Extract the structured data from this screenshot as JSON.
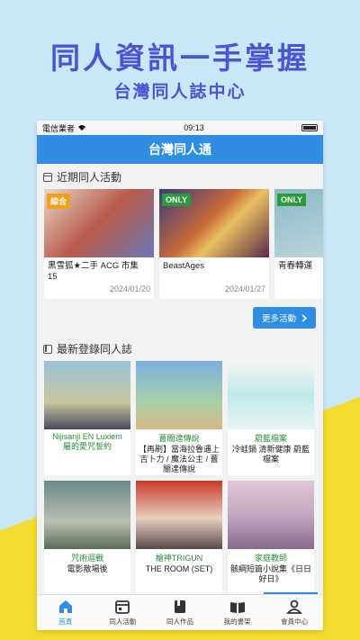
{
  "promo": {
    "headline": "同人資訊一手掌握",
    "subline": "台灣同人誌中心"
  },
  "status_bar": {
    "carrier": "電信業者",
    "time": "09:13"
  },
  "navbar": {
    "title": "台灣同人通"
  },
  "events_section": {
    "title": "近期同人活動",
    "items": [
      {
        "badge": "綜合",
        "badge_color": "#f0a020",
        "title": "黑雪狐★二手 ACG 市集 15",
        "date": "2024/01/20"
      },
      {
        "badge": "ONLY",
        "badge_color": "#2a9a3a",
        "title": "BeastAges",
        "date": "2024/01/27"
      },
      {
        "badge": "ONLY",
        "badge_color": "#2a9a3a",
        "title": "青春轉運",
        "date": ""
      }
    ],
    "more_label": "更多活動"
  },
  "books_section": {
    "title": "最新登錄同人誌",
    "items": [
      {
        "category": "",
        "name": "Nijisanji EN Luxiem\n屬的愛咒誓約",
        "name_color": "#2a8a3a"
      },
      {
        "category": "薔闇達傳說",
        "name": "【再刷】當海拉魯遇上吉卜力 / 魔法公主 / 薔闇達傳說"
      },
      {
        "category": "蔚藍檔案",
        "name": "冷蛙鍋 清新健康 蔚藍檔案"
      },
      {
        "category": "咒術迴戰",
        "name": "電影散場後"
      },
      {
        "category": "槍神TRIGUN",
        "name": "THE ROOM (SET)"
      },
      {
        "category": "家庭教師",
        "name": "骸綱短篇小說集《日日好日》"
      }
    ]
  },
  "tabs": [
    {
      "label": "首頁",
      "icon": "home-icon",
      "active": true
    },
    {
      "label": "同人活動",
      "icon": "calendar-icon",
      "active": false
    },
    {
      "label": "同人作品",
      "icon": "book-icon",
      "active": false
    },
    {
      "label": "我的書架",
      "icon": "open-book-icon",
      "active": false
    },
    {
      "label": "會員中心",
      "icon": "user-icon",
      "active": false
    }
  ],
  "colors": {
    "accent": "#2f8de4",
    "headline": "#4b55d2",
    "background": "#c9e7f7",
    "yellow": "#f3dc2e"
  }
}
